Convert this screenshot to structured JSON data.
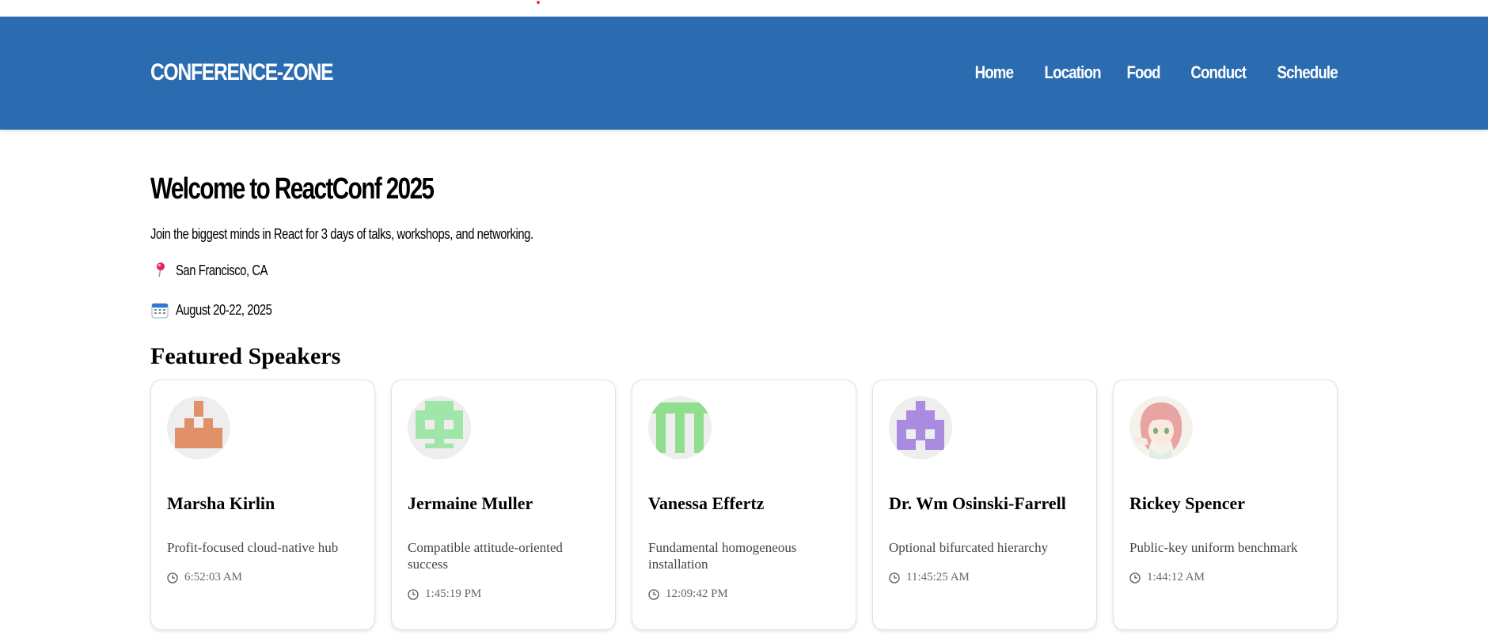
{
  "header": {
    "brand": "CONFERENCE-ZONE",
    "nav": [
      "Home",
      "Location",
      "Food",
      "Conduct",
      "Schedule"
    ]
  },
  "hero": {
    "title": "Welcome to ReactConf 2025",
    "subtitle": "Join the biggest minds in React for 3 days of talks, workshops, and networking.",
    "location": "San Francisco, CA",
    "dates": "August 20-22, 2025"
  },
  "speakers": {
    "title": "Featured Speakers",
    "items": [
      {
        "name": "Marsha Kirlin",
        "description": "Profit-focused cloud-native hub",
        "time": "6:52:03 AM",
        "avatar_icon": "identicon-orange",
        "avatar_color": "#e0916a"
      },
      {
        "name": "Jermaine Muller",
        "description": "Compatible attitude-oriented success",
        "time": "1:45:19 PM",
        "avatar_icon": "identicon-green",
        "avatar_color": "#9fe6a8"
      },
      {
        "name": "Vanessa Effertz",
        "description": "Fundamental homogeneous installation",
        "time": "12:09:42 PM",
        "avatar_icon": "identicon-green",
        "avatar_color": "#92de8f"
      },
      {
        "name": "Dr. Wm Osinski-Farrell",
        "description": "Optional bifurcated hierarchy",
        "time": "11:45:25 AM",
        "avatar_icon": "identicon-purple",
        "avatar_color": "#a98be0"
      },
      {
        "name": "Rickey Spencer",
        "description": "Public-key uniform benchmark",
        "time": "1:44:12 AM",
        "avatar_icon": "anime-portrait",
        "avatar_color": "#e8a4a0"
      }
    ]
  },
  "colors": {
    "header_bg": "#2b6cb0",
    "pin": "#e91e63",
    "calendar": "#2b7bd1"
  }
}
